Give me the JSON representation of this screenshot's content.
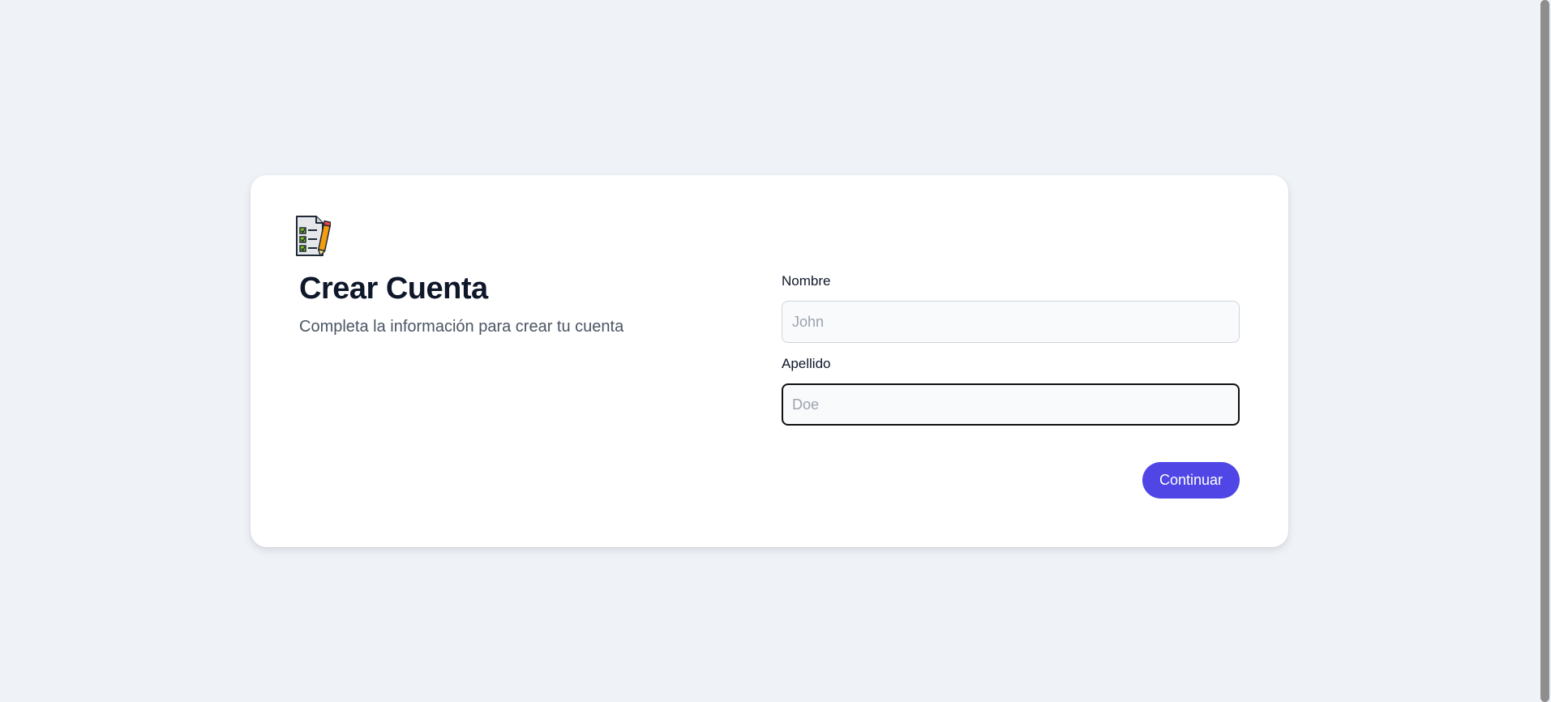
{
  "form": {
    "logo_icon": "checklist-pencil-icon",
    "title": "Crear Cuenta",
    "subtitle": "Completa la información para crear tu cuenta",
    "fields": [
      {
        "label": "Nombre",
        "placeholder": "John",
        "value": ""
      },
      {
        "label": "Apellido",
        "placeholder": "Doe",
        "value": ""
      }
    ],
    "submit_label": "Continuar"
  },
  "colors": {
    "page_background": "#eff2f7",
    "card_background": "#ffffff",
    "accent": "#4f46e5",
    "title_text": "#0f172a",
    "subtitle_text": "#4b5563"
  }
}
